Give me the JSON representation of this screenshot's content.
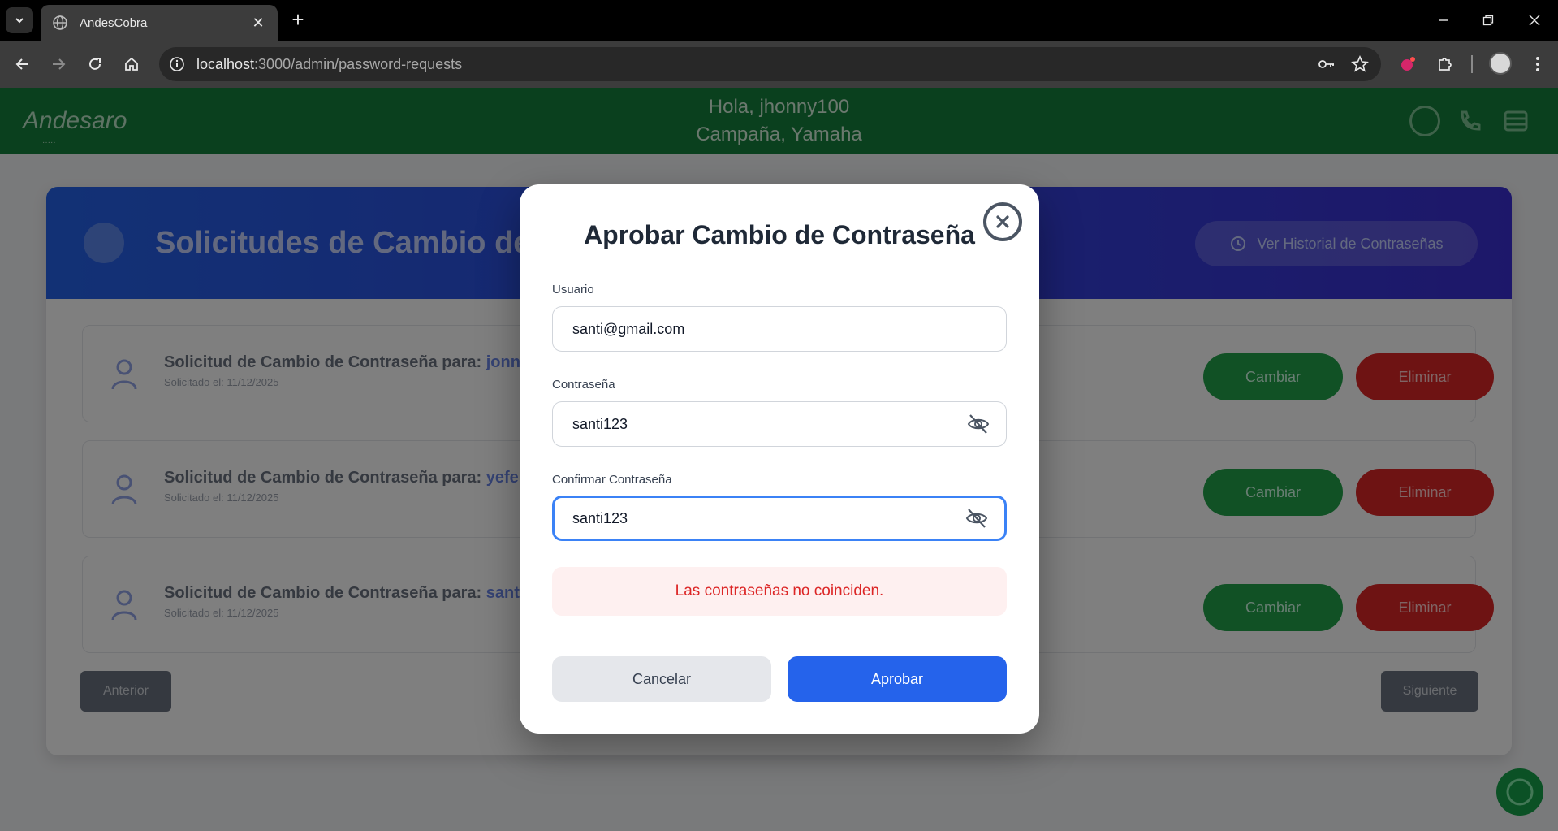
{
  "browser": {
    "tab_title": "AndesCobra",
    "url_host": "localhost",
    "url_rest": ":3000/admin/password-requests",
    "new_tab": "+",
    "tab_close": "✕"
  },
  "app": {
    "logo": "Andesaro",
    "logo_sub": "·····",
    "greeting": "Hola, jhonny100",
    "campaign": "Campaña, Yamaha"
  },
  "page": {
    "title": "Solicitudes de Cambio de",
    "history_button": "Ver Historial de Contraseñas",
    "requests": [
      {
        "title": "Solicitud de Cambio de Contraseña para:",
        "user": "jonny",
        "date": "Solicitado el: 11/12/2025",
        "change": "Cambiar",
        "delete": "Eliminar"
      },
      {
        "title": "Solicitud de Cambio de Contraseña para:",
        "user": "yefer",
        "date": "Solicitado el: 11/12/2025",
        "change": "Cambiar",
        "delete": "Eliminar"
      },
      {
        "title": "Solicitud de Cambio de Contraseña para:",
        "user": "santi@",
        "date": "Solicitado el: 11/12/2025",
        "change": "Cambiar",
        "delete": "Eliminar"
      }
    ],
    "prev": "Anterior",
    "next": "Siguiente"
  },
  "modal": {
    "title": "Aprobar Cambio de Contraseña",
    "user_label": "Usuario",
    "user_value": "santi@gmail.com",
    "password_label": "Contraseña",
    "password_value": "santi123",
    "confirm_label": "Confirmar Contraseña",
    "confirm_value": "santi123",
    "error": "Las contraseñas no coinciden.",
    "cancel": "Cancelar",
    "approve": "Aprobar"
  },
  "colors": {
    "header_green": "#15803d",
    "primary_blue": "#2563eb",
    "error_red": "#dc2626"
  },
  "icons": [
    "chevron-down-icon",
    "globe-icon",
    "close-icon",
    "back-icon",
    "forward-icon",
    "reload-icon",
    "home-icon",
    "info-icon",
    "key-icon",
    "star-icon",
    "extension-icon",
    "puzzle-icon",
    "menu-icon",
    "eye-off-icon",
    "user-icon",
    "whatsapp-icon"
  ]
}
